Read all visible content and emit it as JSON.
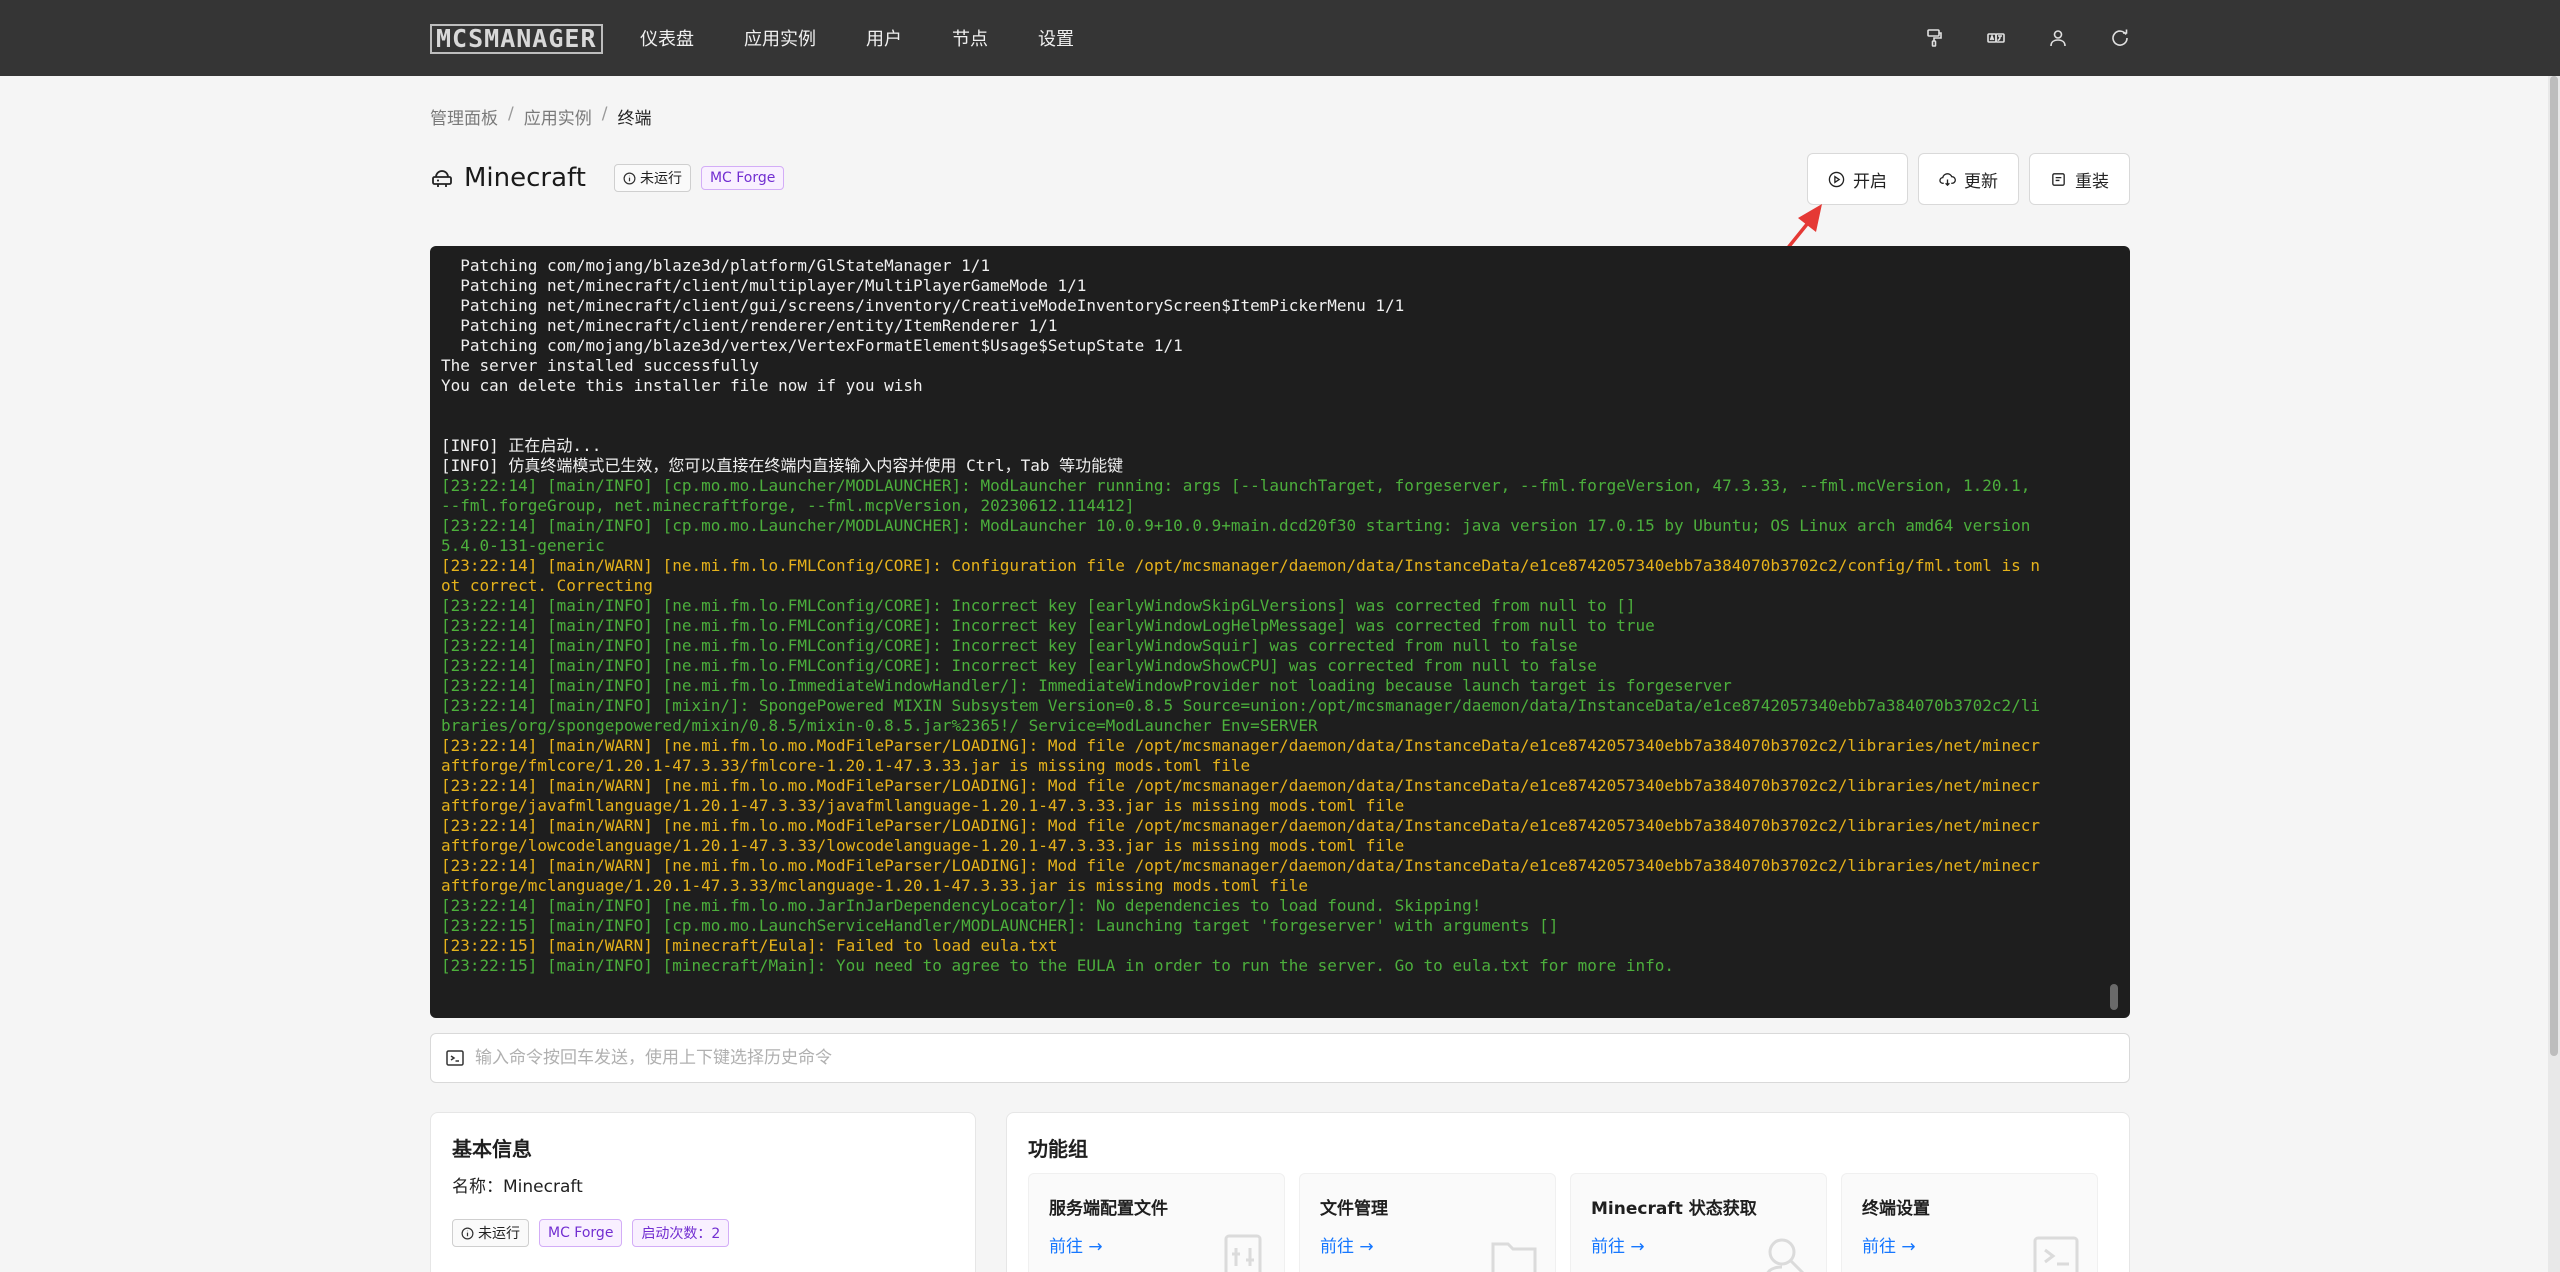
{
  "header": {
    "logo": "MCSMANAGER",
    "nav": [
      "仪表盘",
      "应用实例",
      "用户",
      "节点",
      "设置"
    ],
    "icons": [
      "brush-icon",
      "language-icon",
      "user-icon",
      "logout-icon"
    ]
  },
  "breadcrumb": [
    "管理面板",
    "应用实例",
    "终端"
  ],
  "instance": {
    "name": "Minecraft",
    "status": "未运行",
    "type": "MC Forge",
    "actions": {
      "start": "开启",
      "update": "更新",
      "reinstall": "重装"
    }
  },
  "terminal": {
    "lines": [
      {
        "text": "  Patching com/mojang/blaze3d/platform/GlStateManager 1/1",
        "color": "white"
      },
      {
        "text": "  Patching net/minecraft/client/multiplayer/MultiPlayerGameMode 1/1",
        "color": "white"
      },
      {
        "text": "  Patching net/minecraft/client/gui/screens/inventory/CreativeModeInventoryScreen$ItemPickerMenu 1/1",
        "color": "white"
      },
      {
        "text": "  Patching net/minecraft/client/renderer/entity/ItemRenderer 1/1",
        "color": "white"
      },
      {
        "text": "  Patching com/mojang/blaze3d/vertex/VertexFormatElement$Usage$SetupState 1/1",
        "color": "white"
      },
      {
        "text": "The server installed successfully",
        "color": "white"
      },
      {
        "text": "You can delete this installer file now if you wish",
        "color": "white"
      },
      {
        "text": "",
        "color": "white"
      },
      {
        "text": "",
        "color": "white"
      },
      {
        "text": "[INFO] 正在启动...",
        "color": "white"
      },
      {
        "text": "[INFO] 仿真终端模式已生效，您可以直接在终端内直接输入内容并使用 Ctrl，Tab 等功能键",
        "color": "white"
      },
      {
        "text": "[23:22:14] [main/INFO] [cp.mo.mo.Launcher/MODLAUNCHER]: ModLauncher running: args [--launchTarget, forgeserver, --fml.forgeVersion, 47.3.33, --fml.mcVersion, 1.20.1,",
        "color": "green"
      },
      {
        "text": "--fml.forgeGroup, net.minecraftforge, --fml.mcpVersion, 20230612.114412]",
        "color": "green"
      },
      {
        "text": "[23:22:14] [main/INFO] [cp.mo.mo.Launcher/MODLAUNCHER]: ModLauncher 10.0.9+10.0.9+main.dcd20f30 starting: java version 17.0.15 by Ubuntu; OS Linux arch amd64 version",
        "color": "green"
      },
      {
        "text": "5.4.0-131-generic",
        "color": "green"
      },
      {
        "text": "[23:22:14] [main/WARN] [ne.mi.fm.lo.FMLConfig/CORE]: Configuration file /opt/mcsmanager/daemon/data/InstanceData/e1ce8742057340ebb7a384070b3702c2/config/fml.toml is n",
        "color": "yellow"
      },
      {
        "text": "ot correct. Correcting",
        "color": "yellow"
      },
      {
        "text": "[23:22:14] [main/INFO] [ne.mi.fm.lo.FMLConfig/CORE]: Incorrect key [earlyWindowSkipGLVersions] was corrected from null to []",
        "color": "green"
      },
      {
        "text": "[23:22:14] [main/INFO] [ne.mi.fm.lo.FMLConfig/CORE]: Incorrect key [earlyWindowLogHelpMessage] was corrected from null to true",
        "color": "green"
      },
      {
        "text": "[23:22:14] [main/INFO] [ne.mi.fm.lo.FMLConfig/CORE]: Incorrect key [earlyWindowSquir] was corrected from null to false",
        "color": "green"
      },
      {
        "text": "[23:22:14] [main/INFO] [ne.mi.fm.lo.FMLConfig/CORE]: Incorrect key [earlyWindowShowCPU] was corrected from null to false",
        "color": "green"
      },
      {
        "text": "[23:22:14] [main/INFO] [ne.mi.fm.lo.ImmediateWindowHandler/]: ImmediateWindowProvider not loading because launch target is forgeserver",
        "color": "green"
      },
      {
        "text": "[23:22:14] [main/INFO] [mixin/]: SpongePowered MIXIN Subsystem Version=0.8.5 Source=union:/opt/mcsmanager/daemon/data/InstanceData/e1ce8742057340ebb7a384070b3702c2/li",
        "color": "green"
      },
      {
        "text": "braries/org/spongepowered/mixin/0.8.5/mixin-0.8.5.jar%2365!/ Service=ModLauncher Env=SERVER",
        "color": "green"
      },
      {
        "text": "[23:22:14] [main/WARN] [ne.mi.fm.lo.mo.ModFileParser/LOADING]: Mod file /opt/mcsmanager/daemon/data/InstanceData/e1ce8742057340ebb7a384070b3702c2/libraries/net/minecr",
        "color": "yellow"
      },
      {
        "text": "aftforge/fmlcore/1.20.1-47.3.33/fmlcore-1.20.1-47.3.33.jar is missing mods.toml file",
        "color": "yellow"
      },
      {
        "text": "[23:22:14] [main/WARN] [ne.mi.fm.lo.mo.ModFileParser/LOADING]: Mod file /opt/mcsmanager/daemon/data/InstanceData/e1ce8742057340ebb7a384070b3702c2/libraries/net/minecr",
        "color": "yellow"
      },
      {
        "text": "aftforge/javafmllanguage/1.20.1-47.3.33/javafmllanguage-1.20.1-47.3.33.jar is missing mods.toml file",
        "color": "yellow"
      },
      {
        "text": "[23:22:14] [main/WARN] [ne.mi.fm.lo.mo.ModFileParser/LOADING]: Mod file /opt/mcsmanager/daemon/data/InstanceData/e1ce8742057340ebb7a384070b3702c2/libraries/net/minecr",
        "color": "yellow"
      },
      {
        "text": "aftforge/lowcodelanguage/1.20.1-47.3.33/lowcodelanguage-1.20.1-47.3.33.jar is missing mods.toml file",
        "color": "yellow"
      },
      {
        "text": "[23:22:14] [main/WARN] [ne.mi.fm.lo.mo.ModFileParser/LOADING]: Mod file /opt/mcsmanager/daemon/data/InstanceData/e1ce8742057340ebb7a384070b3702c2/libraries/net/minecr",
        "color": "yellow"
      },
      {
        "text": "aftforge/mclanguage/1.20.1-47.3.33/mclanguage-1.20.1-47.3.33.jar is missing mods.toml file",
        "color": "yellow"
      },
      {
        "text": "[23:22:14] [main/INFO] [ne.mi.fm.lo.mo.JarInJarDependencyLocator/]: No dependencies to load found. Skipping!",
        "color": "green"
      },
      {
        "text": "[23:22:15] [main/INFO] [cp.mo.mo.LaunchServiceHandler/MODLAUNCHER]: Launching target 'forgeserver' with arguments []",
        "color": "green"
      },
      {
        "text": "[23:22:15] [main/WARN] [minecraft/Eula]: Failed to load eula.txt",
        "color": "yellow"
      },
      {
        "text": "[23:22:15] [main/INFO] [minecraft/Main]: You need to agree to the EULA in order to run the server. Go to eula.txt for more info.",
        "color": "green"
      }
    ]
  },
  "command": {
    "placeholder": "输入命令按回车发送，使用上下键选择历史命令"
  },
  "basic_info": {
    "title": "基本信息",
    "name_line": "名称：Minecraft",
    "status": "未运行",
    "type": "MC Forge",
    "start_count": "启动次数：2"
  },
  "features": {
    "title": "功能组",
    "items": [
      {
        "title": "服务端配置文件",
        "link": "前往 →"
      },
      {
        "title": "文件管理",
        "link": "前往 →"
      },
      {
        "title": "Minecraft 状态获取",
        "link": "前往 →"
      },
      {
        "title": "终端设置",
        "link": "前往 →"
      }
    ]
  },
  "colors": {
    "terminal_bg": "#1e1e1e",
    "log_info": "#4caf3c",
    "log_warn": "#e5b21b",
    "link": "#1677ff",
    "annotation_arrow": "#e53935"
  }
}
